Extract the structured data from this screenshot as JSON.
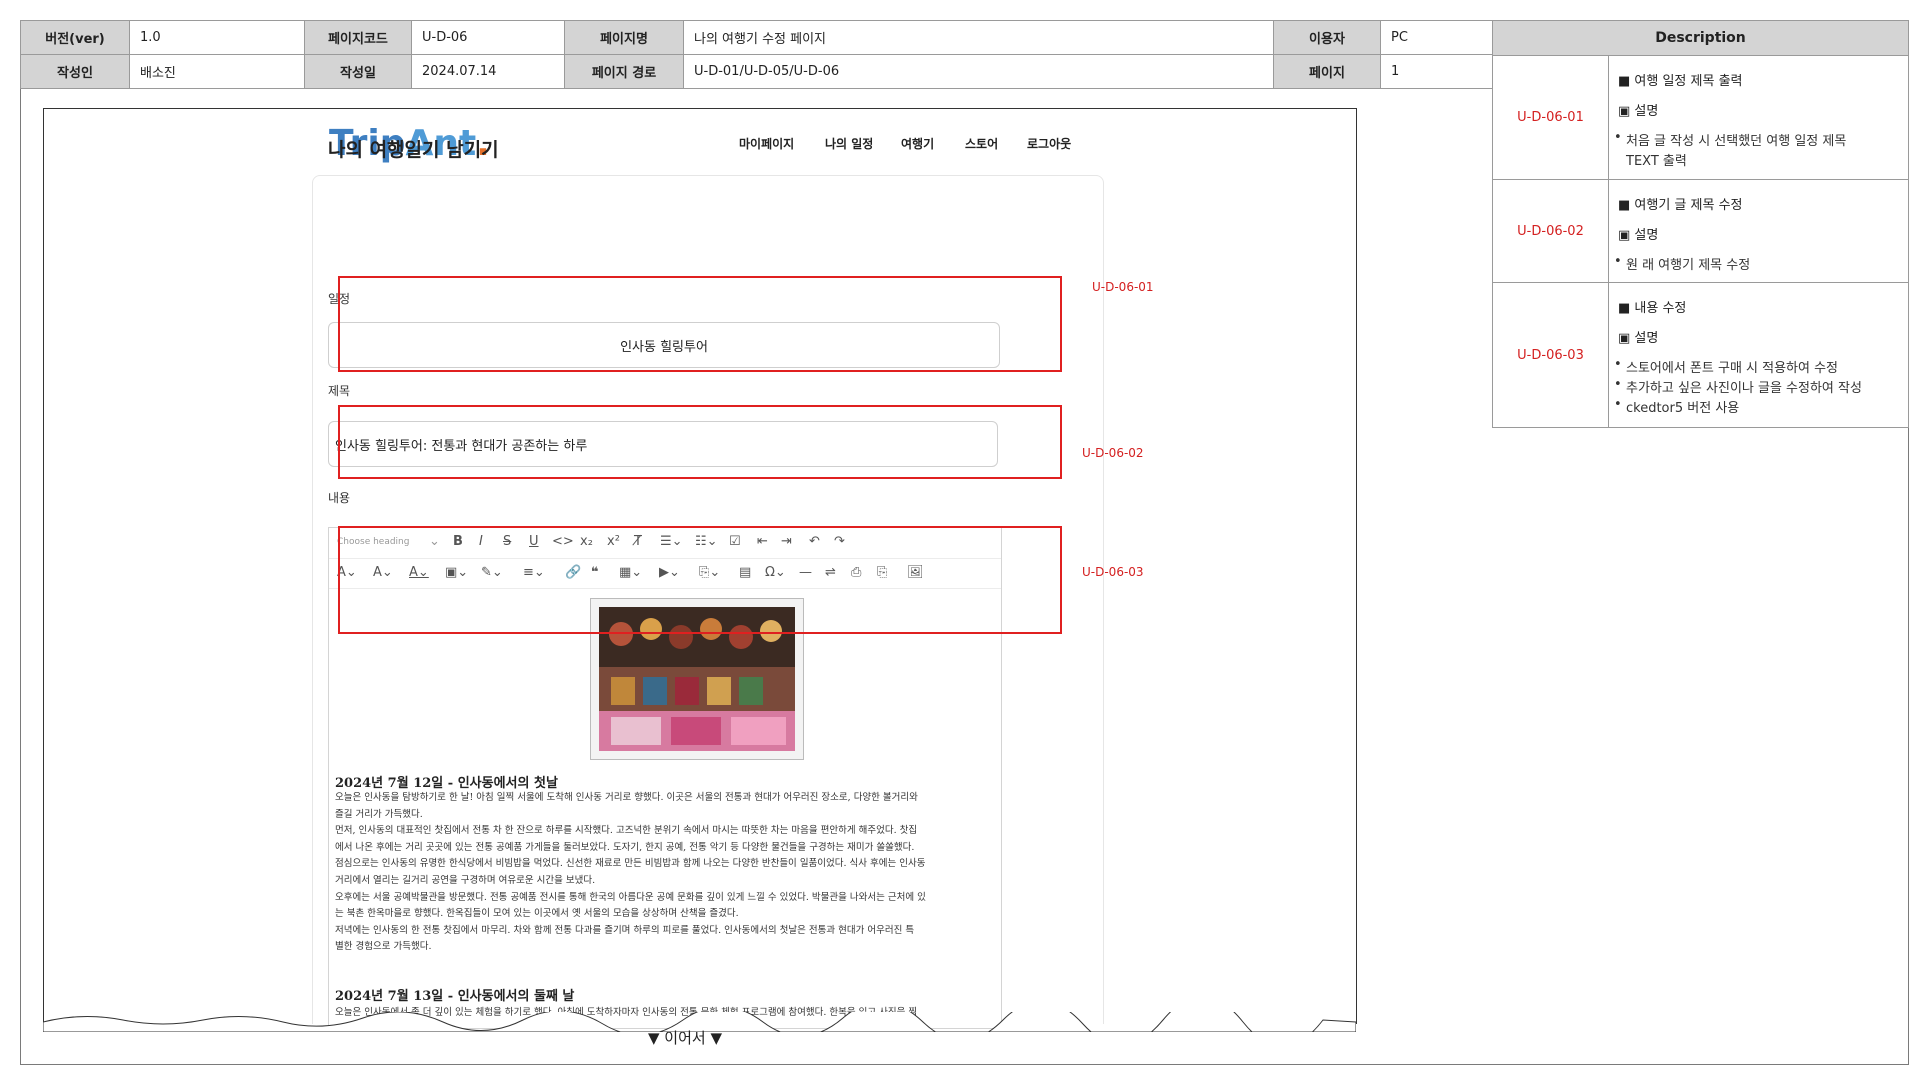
{
  "header": {
    "version_label": "버전(ver)",
    "version_value": "1.0",
    "pagecode_label": "페이지코드",
    "pagecode_value": "U-D-06",
    "pagename_label": "페이지명",
    "pagename_value": "나의 여행기 수정 페이지",
    "user_label": "이용자",
    "user_value": "PC",
    "author_label": "작성인",
    "author_value": "배소진",
    "date_label": "작성일",
    "date_value": "2024.07.14",
    "path_label": "페이지 경로",
    "path_value": "U-D-01/U-D-05/U-D-06",
    "page_label": "페이지",
    "page_value": "1"
  },
  "site": {
    "logo_part1": "Trip",
    "logo_part2": "Ant",
    "logo_dot": ".",
    "nav": [
      "마이페이지",
      "나의 일정",
      "여행기",
      "스토어",
      "로그아웃"
    ]
  },
  "form": {
    "title": "나의 여행일기 남기기",
    "schedule_label": "일정",
    "schedule_value": "인사동 힐링투어",
    "subject_label": "제목",
    "subject_value": "인사동 힐링투어: 전통과 현대가 공존하는 하루",
    "content_label": "내용",
    "heading_select": "Choose heading"
  },
  "annotations": [
    "U-D-06-01",
    "U-D-06-02",
    "U-D-06-03"
  ],
  "article": {
    "day1_heading": "2024년 7월 12일 - 인사동에서의 첫날",
    "day1_lines": [
      "오늘은 인사동을 탐방하기로 한 날! 아침 일찍 서울에 도착해 인사동 거리로 향했다. 이곳은 서울의 전통과 현대가 어우러진 장소로, 다양한 볼거리와",
      "즐길 거리가 가득했다.",
      "먼저, 인사동의 대표적인 찻집에서 전통 차 한 잔으로 하루를 시작했다. 고즈넉한 분위기 속에서 마시는 따뜻한 차는 마음을 편안하게 해주었다. 찻집",
      "에서 나온 후에는 거리 곳곳에 있는 전통 공예품 가게들을 둘러보았다. 도자기, 한지 공예, 전통 악기 등 다양한 물건들을 구경하는 재미가 쏠쏠했다.",
      "점심으로는 인사동의 유명한 한식당에서 비빔밥을 먹었다. 신선한 재료로 만든 비빔밥과 함께 나오는 다양한 반찬들이 일품이었다. 식사 후에는 인사동",
      "거리에서 열리는 길거리 공연을 구경하며 여유로운 시간을 보냈다.",
      "오후에는 서울 공예박물관을 방문했다. 전통 공예품 전시를 통해 한국의 아름다운 공예 문화를 깊이 있게 느낄 수 있었다. 박물관을 나와서는 근처에 있",
      "는 북촌 한옥마을로 향했다. 한옥집들이 모여 있는 이곳에서 옛 서울의 모습을 상상하며 산책을 즐겼다.",
      "저녁에는 인사동의 한 전통 찻집에서 마무리. 차와 함께 전통 다과를 즐기며 하루의 피로를 풀었다. 인사동에서의 첫날은 전통과 현대가 어우러진 특",
      "별한 경험으로 가득했다."
    ],
    "day2_heading": "2024년 7월 13일 - 인사동에서의 둘째 날",
    "day2_lines": [
      "오늘은 인사동에서 좀 더 깊이 있는 체험을 하기로 했다. 아침에 도착하자마자 인사동의 전통 문화 체험 프로그램에 참여했다. 한복을 입고 사진을 찍"
    ]
  },
  "continue_text": "▼ 이어서 ▼",
  "description": {
    "title": "Description",
    "rows": [
      {
        "id": "U-D-06-01",
        "title": "■ 여행 일정 제목 출력",
        "sub": "▣ 설명",
        "bullets": [
          "처음 글 작성 시 선택했던 여행 일정 제목",
          "TEXT 출력"
        ]
      },
      {
        "id": "U-D-06-02",
        "title": "■ 여행기 글 제목 수정",
        "sub": "▣ 설명",
        "bullets": [
          "원 래 여행기 제목 수정"
        ]
      },
      {
        "id": "U-D-06-03",
        "title": "■ 내용 수정",
        "sub": "▣ 설명",
        "bullets": [
          "스토어에서 폰트 구매 시 적용하여 수정",
          "추가하고 싶은 사진이나 글을 수정하여 작성",
          "ckedtor5 버전 사용"
        ]
      }
    ]
  },
  "colors": {
    "annotation_red": "#e02020",
    "label_gray": "#d4d4d4",
    "logo_blue": "#3e7fc1",
    "logo_dot": "#e4702a"
  }
}
